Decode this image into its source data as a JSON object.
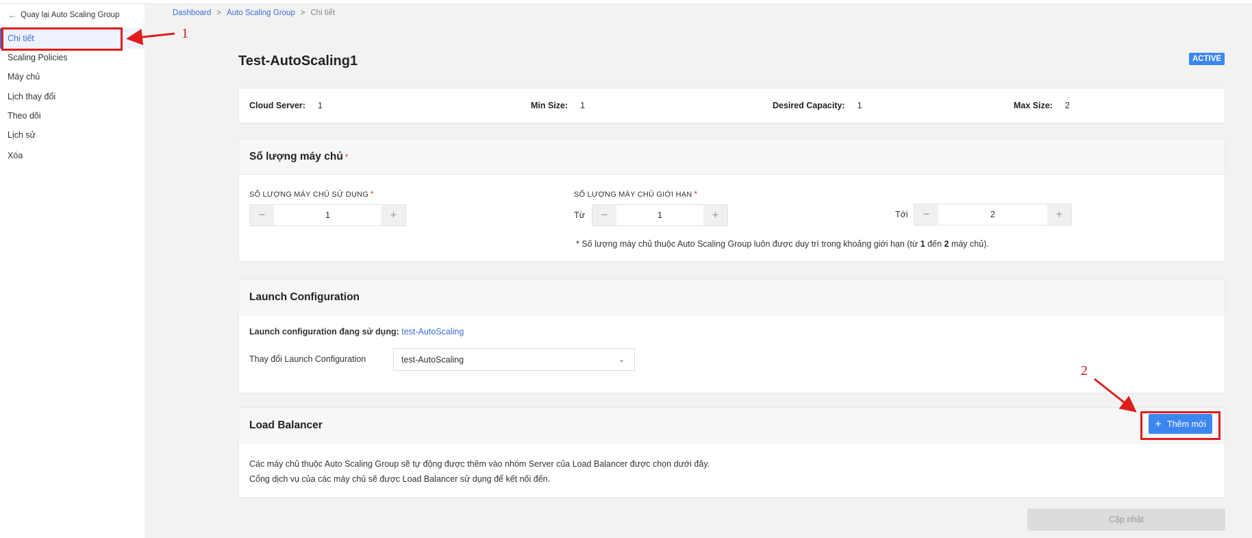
{
  "sidebar": {
    "back_label": "Quay lại Auto Scaling Group",
    "items": [
      {
        "label": "Chi tiết",
        "active": true
      },
      {
        "label": "Scaling Policies"
      },
      {
        "label": "Máy chủ"
      },
      {
        "label": "Lịch thay đổi"
      },
      {
        "label": "Theo dõi"
      },
      {
        "label": "Lịch sử"
      },
      {
        "label": "Xóa"
      }
    ]
  },
  "breadcrumb": {
    "items": [
      "Dashboard",
      "Auto Scaling Group",
      "Chi tiết"
    ],
    "separator": ">"
  },
  "page": {
    "title": "Test-AutoScaling1",
    "status": "ACTIVE"
  },
  "summary": {
    "cloud_server": {
      "label": "Cloud Server:",
      "value": "1"
    },
    "min_size": {
      "label": "Min Size:",
      "value": "1"
    },
    "desired": {
      "label": "Desired Capacity:",
      "value": "1"
    },
    "max_size": {
      "label": "Max Size:",
      "value": "2"
    }
  },
  "capacity": {
    "title": "Số lượng máy chủ",
    "required_mark": "*",
    "used_label": "SỐ LƯỢNG MÁY CHỦ SỬ DỤNG",
    "used_value": "1",
    "limit_label": "SỐ LƯỢNG MÁY CHỦ GIỚI HẠN",
    "from_label": "Từ",
    "from_value": "1",
    "to_label": "Tới",
    "to_value": "2",
    "minus": "−",
    "plus": "+",
    "note_prefix": "* Số lượng máy chủ thuộc Auto Scaling Group luôn được duy trì trong khoảng giới hạn (từ ",
    "note_min": "1",
    "note_mid": " đến ",
    "note_max": "2",
    "note_suffix": " máy chủ)."
  },
  "launch_config": {
    "title": "Launch Configuration",
    "current_label": "Launch configuration đang sử dụng:",
    "current_value": "test-AutoScaling",
    "change_label": "Thay đổi Launch Configuration",
    "selected": "test-AutoScaling"
  },
  "load_balancer": {
    "title": "Load Balancer",
    "add_label": "Thêm mới",
    "desc_line1": "Các máy chủ thuộc Auto Scaling Group sẽ tự động được thêm vào nhóm Server của Load Balancer được chọn dưới đây.",
    "desc_line2": "Cổng dịch vụ của các máy chủ sẽ được Load Balancer sử dụng để kết nối đến."
  },
  "actions": {
    "update_label": "Cập nhật"
  },
  "annotations": {
    "marker_1": "1",
    "marker_2": "2"
  },
  "colors": {
    "accent": "#3d86f0",
    "link": "#3b6ed8",
    "annotation": "#e11c1c",
    "required": "#e03131"
  }
}
